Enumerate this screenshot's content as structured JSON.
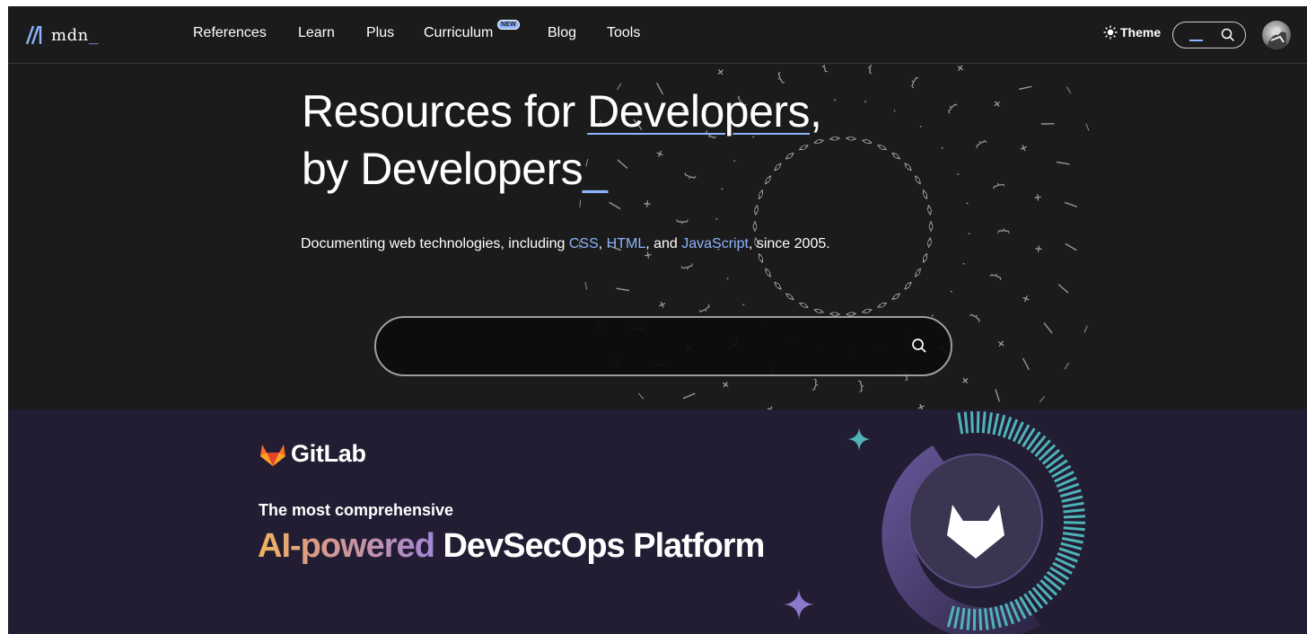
{
  "nav": {
    "logo_text": "mdn",
    "logo_underscore": "_",
    "items": [
      {
        "label": "References"
      },
      {
        "label": "Learn"
      },
      {
        "label": "Plus"
      },
      {
        "label": "Curriculum",
        "badge": "NEW"
      },
      {
        "label": "Blog"
      },
      {
        "label": "Tools"
      }
    ],
    "theme_label": "Theme",
    "theme_icon": "sun-icon",
    "search_icon": "search-icon"
  },
  "hero": {
    "title_part1": "Resources for ",
    "title_link": "Developers",
    "title_comma": ",",
    "title_line2": "by Developers",
    "title_cursor": "_",
    "subtitle_prefix": "Documenting web technologies, including ",
    "link_css": "CSS",
    "sep1": ", ",
    "link_html": "HTML",
    "sep2": ", and ",
    "link_js": "JavaScript",
    "subtitle_suffix": ", since 2005.",
    "search_placeholder": ""
  },
  "ad": {
    "brand": "GitLab",
    "tagline_small": "The most comprehensive",
    "tagline_gradient": "AI-powered",
    "tagline_rest": " DevSecOps Platform",
    "colors": {
      "background": "#221d33",
      "gradient_start": "#f0b45a",
      "gradient_end": "#a387d6",
      "teal": "#4fb3b8",
      "fox": "#fc6d26"
    }
  },
  "colors": {
    "page_bg": "#1b1b1b",
    "accent": "#8cb4ff",
    "text": "#ffffff"
  }
}
